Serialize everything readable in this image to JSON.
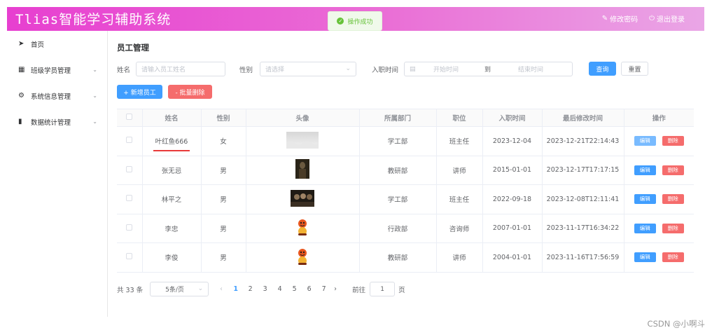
{
  "header": {
    "title": "Tlias智能学习辅助系统",
    "change_password": "修改密码",
    "logout": "退出登录"
  },
  "toast": {
    "text": "操作成功"
  },
  "sidebar": {
    "items": [
      {
        "label": "首页",
        "icon": "send-icon",
        "has_chevron": false
      },
      {
        "label": "班级学员管理",
        "icon": "grid-icon",
        "has_chevron": true
      },
      {
        "label": "系统信息管理",
        "icon": "gear-icon",
        "has_chevron": true
      },
      {
        "label": "数据统计管理",
        "icon": "bar-chart-icon",
        "has_chevron": true
      }
    ]
  },
  "main": {
    "title": "员工管理",
    "filters": {
      "name_label": "姓名",
      "name_placeholder": "请输入员工姓名",
      "gender_label": "性别",
      "gender_placeholder": "请选择",
      "date_label": "入职时间",
      "start_placeholder": "开始时间",
      "date_separator": "到",
      "end_placeholder": "结束时间",
      "search_button": "查询",
      "reset_button": "重置"
    },
    "actions": {
      "add_button": "+ 新增员工",
      "batch_delete_button": "- 批量删除"
    },
    "table": {
      "columns": [
        "姓名",
        "性别",
        "头像",
        "所属部门",
        "职位",
        "入职时间",
        "最后修改时间",
        "操作"
      ],
      "edit_label": "编辑",
      "delete_label": "删除",
      "rows": [
        {
          "name": "叶红鱼666",
          "gender": "女",
          "dept": "学工部",
          "position": "班主任",
          "entry": "2023-12-04",
          "updated": "2023-12-21T22:14:43"
        },
        {
          "name": "张无忌",
          "gender": "男",
          "dept": "教研部",
          "position": "讲师",
          "entry": "2015-01-01",
          "updated": "2023-12-17T17:17:15"
        },
        {
          "name": "林平之",
          "gender": "男",
          "dept": "学工部",
          "position": "班主任",
          "entry": "2022-09-18",
          "updated": "2023-12-08T12:11:41"
        },
        {
          "name": "李忠",
          "gender": "男",
          "dept": "行政部",
          "position": "咨询师",
          "entry": "2007-01-01",
          "updated": "2023-11-17T16:34:22"
        },
        {
          "name": "李俊",
          "gender": "男",
          "dept": "教研部",
          "position": "讲师",
          "entry": "2004-01-01",
          "updated": "2023-11-16T17:56:59"
        }
      ]
    },
    "pagination": {
      "total": "共 33 条",
      "page_size": "5条/页",
      "pages": [
        "1",
        "2",
        "3",
        "4",
        "5",
        "6",
        "7"
      ],
      "current": "1",
      "goto_label": "前往",
      "goto_value": "1",
      "page_unit": "页"
    }
  },
  "watermark": "CSDN @小啊斗"
}
